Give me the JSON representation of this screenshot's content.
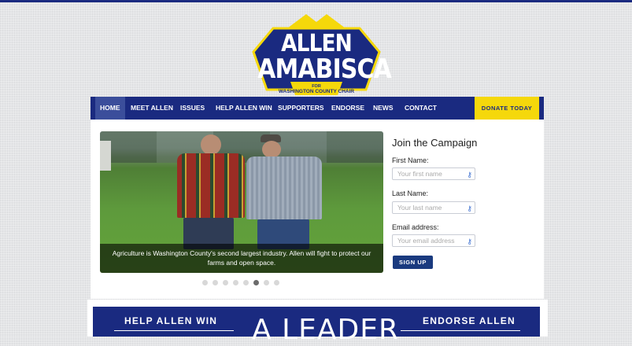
{
  "logo": {
    "line1": "ALLEN",
    "line2": "AMABISCA",
    "tag1": "FOR",
    "tag2": "WASHINGTON COUNTY",
    "tag3": "CHAIR"
  },
  "colors": {
    "brand_blue": "#1a2a80",
    "brand_yellow": "#f5d80b",
    "signup_blue": "#1a3a7f"
  },
  "nav": {
    "items": [
      {
        "label": "HOME"
      },
      {
        "label": "MEET ALLEN"
      },
      {
        "label": "ISSUES"
      },
      {
        "label": "HELP ALLEN WIN"
      },
      {
        "label": "SUPPORTERS"
      },
      {
        "label": "ENDORSE"
      },
      {
        "label": "NEWS"
      },
      {
        "label": "CONTACT"
      }
    ],
    "donate_label": "DONATE TODAY"
  },
  "slider": {
    "caption_line1": "Agriculture is Washington County's second largest industry. Allen will fight to protect our",
    "caption_line2": "farms and open space.",
    "dot_count": 8,
    "active_dot": 6
  },
  "form": {
    "title": "Join the Campaign",
    "first_name_label": "First Name:",
    "first_name_placeholder": "Your first name",
    "last_name_label": "Last Name:",
    "last_name_placeholder": "Your last name",
    "email_label": "Email address:",
    "email_placeholder": "Your email address",
    "submit_label": "SIGN UP",
    "field_icon": "key-icon"
  },
  "band": {
    "left_label": "HELP ALLEN WIN",
    "center_text": "A LEADER",
    "right_label": "ENDORSE ALLEN"
  }
}
